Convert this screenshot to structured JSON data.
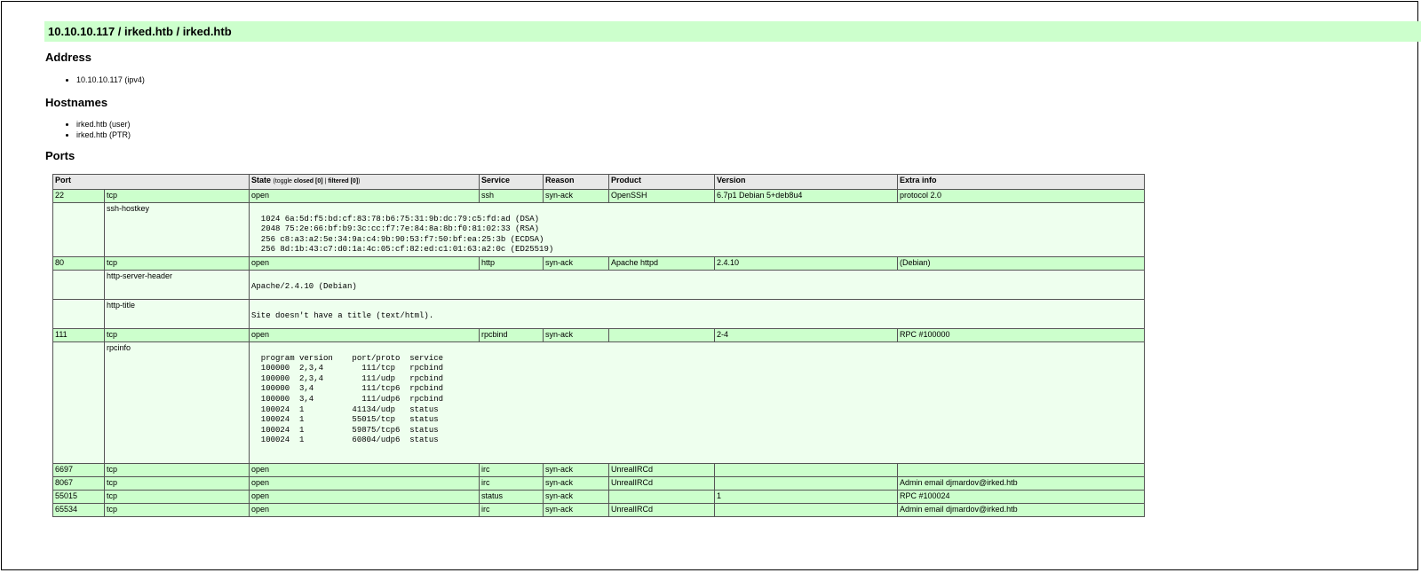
{
  "header": {
    "title": "10.10.10.117 / irked.htb / irked.htb"
  },
  "address": {
    "heading": "Address",
    "items": [
      {
        "value": "10.10.10.117",
        "type": "(ipv4)"
      }
    ]
  },
  "hostnames": {
    "heading": "Hostnames",
    "items": [
      {
        "value": "irked.htb",
        "type": "(user)"
      },
      {
        "value": "irked.htb",
        "type": "(PTR)"
      }
    ]
  },
  "ports": {
    "heading": "Ports",
    "columns": {
      "port": "Port",
      "state": "State",
      "state_toggle_pre": "(toggle",
      "state_closed": "closed [0]",
      "state_sep": "|",
      "state_filtered": "filtered [0]",
      "state_toggle_post": ")",
      "service": "Service",
      "reason": "Reason",
      "product": "Product",
      "version": "Version",
      "extrainfo": "Extra info"
    },
    "rows": [
      {
        "port": "22",
        "proto": "tcp",
        "state": "open",
        "service": "ssh",
        "reason": "syn-ack",
        "product": "OpenSSH",
        "version": "6.7p1 Debian 5+deb8u4",
        "extrainfo": "protocol 2.0"
      },
      {
        "port": "80",
        "proto": "tcp",
        "state": "open",
        "service": "http",
        "reason": "syn-ack",
        "product": "Apache httpd",
        "version": "2.4.10",
        "extrainfo": "(Debian)"
      },
      {
        "port": "111",
        "proto": "tcp",
        "state": "open",
        "service": "rpcbind",
        "reason": "syn-ack",
        "product": "",
        "version": "2-4",
        "extrainfo": "RPC #100000"
      },
      {
        "port": "6697",
        "proto": "tcp",
        "state": "open",
        "service": "irc",
        "reason": "syn-ack",
        "product": "UnrealIRCd",
        "version": "",
        "extrainfo": ""
      },
      {
        "port": "8067",
        "proto": "tcp",
        "state": "open",
        "service": "irc",
        "reason": "syn-ack",
        "product": "UnrealIRCd",
        "version": "",
        "extrainfo": "Admin email djmardov@irked.htb"
      },
      {
        "port": "55015",
        "proto": "tcp",
        "state": "open",
        "service": "status",
        "reason": "syn-ack",
        "product": "",
        "version": "1",
        "extrainfo": "RPC #100024"
      },
      {
        "port": "65534",
        "proto": "tcp",
        "state": "open",
        "service": "irc",
        "reason": "syn-ack",
        "product": "UnrealIRCd",
        "version": "",
        "extrainfo": "Admin email djmardov@irked.htb"
      }
    ],
    "scripts": {
      "ssh_hostkey": {
        "name": "ssh-hostkey",
        "output": "\n  1024 6a:5d:f5:bd:cf:83:78:b6:75:31:9b:dc:79:c5:fd:ad (DSA)\n  2048 75:2e:66:bf:b9:3c:cc:f7:7e:84:8a:8b:f0:81:02:33 (RSA)\n  256 c8:a3:a2:5e:34:9a:c4:9b:90:53:f7:50:bf:ea:25:3b (ECDSA)\n  256 8d:1b:43:c7:d0:1a:4c:05:cf:82:ed:c1:01:63:a2:0c (ED25519)\n"
      },
      "http_server_header": {
        "name": "http-server-header",
        "output": "\nApache/2.4.10 (Debian)"
      },
      "http_title": {
        "name": "http-title",
        "output": "\nSite doesn't have a title (text/html)."
      },
      "rpcinfo": {
        "name": "rpcinfo",
        "output": "\n  program version    port/proto  service\n  100000  2,3,4        111/tcp   rpcbind\n  100000  2,3,4        111/udp   rpcbind\n  100000  3,4          111/tcp6  rpcbind\n  100000  3,4          111/udp6  rpcbind\n  100024  1          41134/udp   status\n  100024  1          55015/tcp   status\n  100024  1          59875/tcp6  status\n  100024  1          60804/udp6  status\n\n"
      }
    }
  }
}
